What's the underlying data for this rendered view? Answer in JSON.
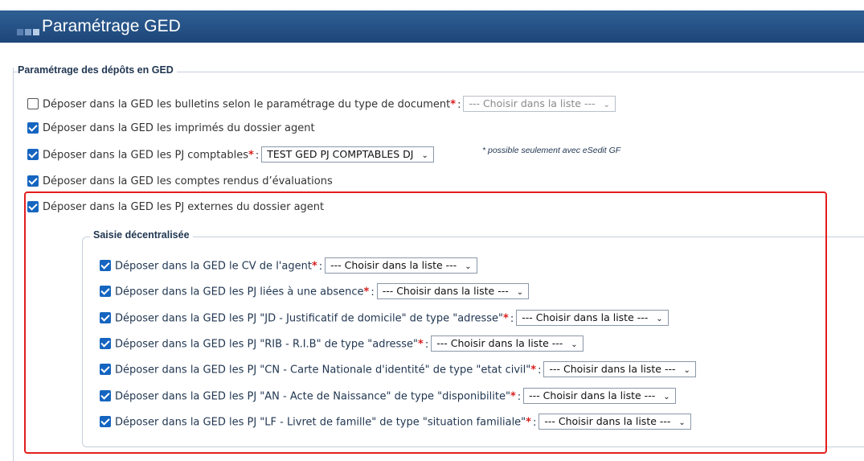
{
  "header": {
    "title": "Paramétrage GED"
  },
  "section": {
    "legend": "Paramétrage des dépôts en GED",
    "rows": [
      {
        "label": "Déposer dans la GED les bulletins selon le paramétrage du type de document",
        "checked": false,
        "required": true,
        "select": "--- Choisir dans la liste ---",
        "select_disabled": true
      },
      {
        "label": "Déposer dans la GED les imprimés du dossier agent",
        "checked": true
      },
      {
        "label": "Déposer dans la GED les PJ comptables",
        "checked": true,
        "required": true,
        "select": "TEST GED PJ COMPTABLES DJ",
        "note": "* possible seulement avec eSedit GF"
      },
      {
        "label": "Déposer dans la GED les comptes rendus d’évaluations",
        "checked": true
      },
      {
        "label": "Déposer dans la GED les PJ externes du dossier agent",
        "checked": true
      }
    ]
  },
  "subsection": {
    "legend": "Saisie décentralisée",
    "rows": [
      {
        "label": "Déposer dans la GED le CV de l'agent",
        "checked": true,
        "required": true,
        "select": "--- Choisir dans la liste ---"
      },
      {
        "label": "Déposer dans la GED les PJ liées à une absence",
        "checked": true,
        "required": true,
        "select": "--- Choisir dans la liste ---"
      },
      {
        "label": "Déposer dans la GED les PJ \"JD - Justificatif de domicile\" de type \"adresse\"",
        "checked": true,
        "required": true,
        "select": "--- Choisir dans la liste ---"
      },
      {
        "label": "Déposer dans la GED les PJ \"RIB - R.I.B\" de type \"adresse\"",
        "checked": true,
        "required": true,
        "select": "--- Choisir dans la liste ---"
      },
      {
        "label": "Déposer dans la GED les PJ \"CN - Carte Nationale d'identité\" de type \"etat civil\"",
        "checked": true,
        "required": true,
        "select": "--- Choisir dans la liste ---"
      },
      {
        "label": "Déposer dans la GED les PJ \"AN - Acte de Naissance\" de type \"disponibilite\"",
        "checked": true,
        "required": true,
        "select": "--- Choisir dans la liste ---"
      },
      {
        "label": "Déposer dans la GED les PJ \"LF - Livret de famille\" de type \"situation familiale\"",
        "checked": true,
        "required": true,
        "select": "--- Choisir dans la liste ---"
      }
    ]
  },
  "required_marker": "*",
  "colon": ":",
  "colors": {
    "header": "#1d4679",
    "checkbox": "#1565c0",
    "required": "#d91c1c",
    "highlight": "#e21e1e"
  }
}
